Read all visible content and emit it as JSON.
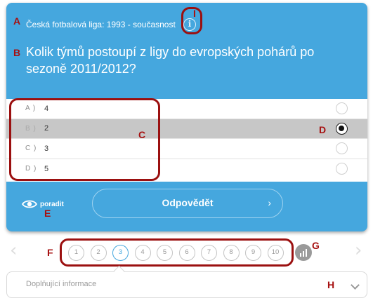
{
  "quiz": {
    "category": "Česká fotbalová liga: 1993 - současnost",
    "info_icon": "i",
    "question": "Kolik týmů postoupí z ligy do evropských pohárů po sezoně 2011/2012?",
    "answers": [
      {
        "letter": "A )",
        "text": "4",
        "selected": false
      },
      {
        "letter": "B )",
        "text": "2",
        "selected": true
      },
      {
        "letter": "C )",
        "text": "3",
        "selected": false
      },
      {
        "letter": "D )",
        "text": "5",
        "selected": false
      }
    ],
    "hint_label": "poradit",
    "hint_icon": "eye-icon",
    "answer_button": "Odpovědět",
    "answer_button_chevron": "›"
  },
  "pager": {
    "prev": "‹",
    "next": "›",
    "pages": [
      "1",
      "2",
      "3",
      "4",
      "5",
      "6",
      "7",
      "8",
      "9",
      "10"
    ],
    "current": "3",
    "stats_icon": "bar-chart-icon"
  },
  "more_info": {
    "label": "Doplňující informace"
  },
  "annotations": [
    "A",
    "B",
    "C",
    "D",
    "E",
    "F",
    "G",
    "H",
    "I"
  ],
  "colors": {
    "card_blue": "#45a7de",
    "annotation_red": "#a61010",
    "selected_row": "#c7c7c7"
  }
}
